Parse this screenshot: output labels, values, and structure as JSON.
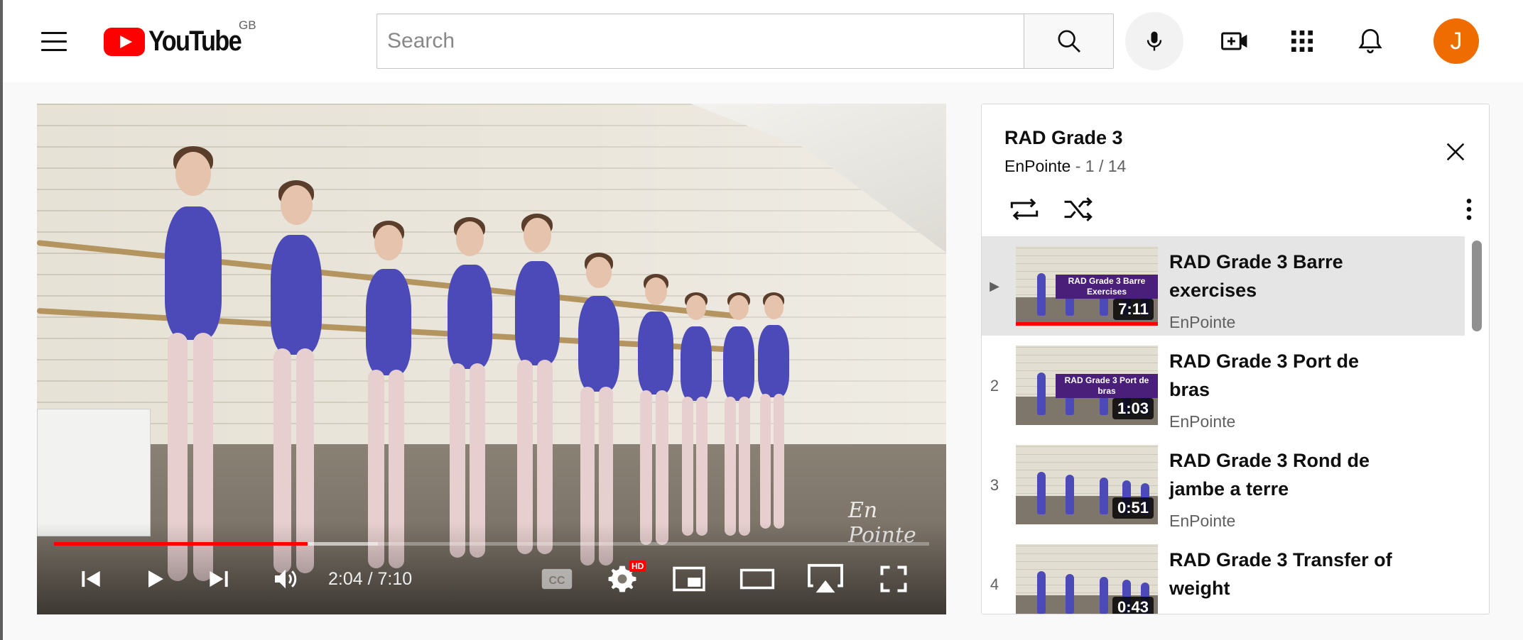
{
  "header": {
    "logo_text": "YouTube",
    "region": "GB",
    "search_placeholder": "Search",
    "avatar_initial": "J",
    "avatar_color": "#ef6c00",
    "icons": [
      "hamburger-menu-icon",
      "search-icon",
      "microphone-icon",
      "create-video-icon",
      "apps-grid-icon",
      "notifications-bell-icon"
    ]
  },
  "player": {
    "time_current": "2:04",
    "time_separator": " / ",
    "time_total": "7:10",
    "played_fraction": 0.29,
    "buffered_fraction": 0.37,
    "hd_badge": "HD",
    "watermark": "En Pointe",
    "controls": [
      "previous-icon",
      "play-icon",
      "next-icon",
      "volume-icon",
      "subtitles-icon",
      "settings-gear-icon",
      "miniplayer-icon",
      "theater-mode-icon",
      "airplay-icon",
      "fullscreen-icon"
    ]
  },
  "playlist": {
    "title": "RAD Grade 3",
    "channel": "EnPointe",
    "position": " - 1 / 14",
    "items": [
      {
        "index": "▶",
        "title": "RAD Grade 3 Barre exercises",
        "channel": "EnPointe",
        "duration": "7:11",
        "thumb_text": "RAD Grade 3 Barre Exercises",
        "selected": true,
        "watched_fraction": 1.0
      },
      {
        "index": "2",
        "title": "RAD Grade 3 Port de bras",
        "channel": "EnPointe",
        "duration": "1:03",
        "thumb_text": "RAD Grade 3 Port de bras",
        "selected": false
      },
      {
        "index": "3",
        "title": "RAD Grade 3 Rond de jambe a terre",
        "channel": "EnPointe",
        "duration": "0:51",
        "thumb_text": "",
        "selected": false
      },
      {
        "index": "4",
        "title": "RAD Grade 3 Transfer of weight",
        "channel": "EnPointe",
        "duration": "0:43",
        "thumb_text": "",
        "selected": false
      }
    ]
  },
  "colors": {
    "accent_red": "#ff0000",
    "leotard_blue": "#4c4ab8"
  }
}
